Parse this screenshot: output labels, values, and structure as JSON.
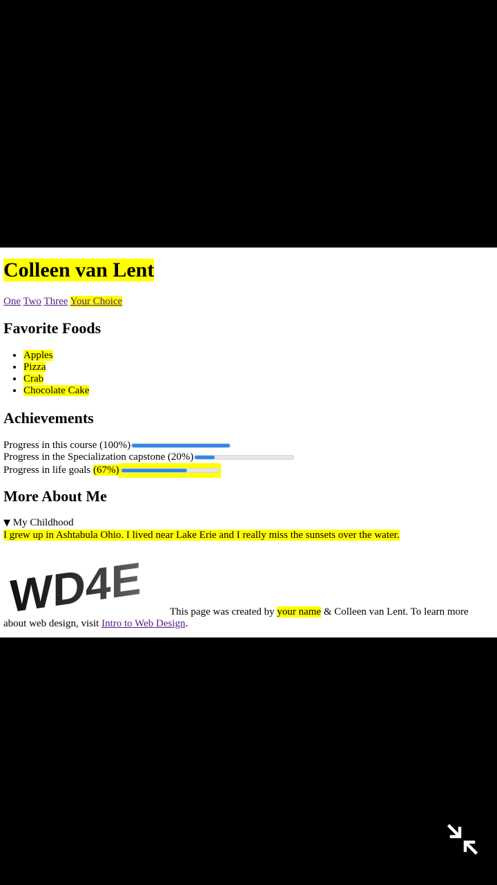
{
  "title": "Colleen van Lent",
  "nav": {
    "links": [
      "One",
      "Two",
      "Three",
      "Your Choice"
    ]
  },
  "favorite_foods": {
    "heading": "Favorite Foods",
    "items": [
      "Apples",
      "Pizza",
      "Crab",
      "Chocolate Cake"
    ]
  },
  "achievements": {
    "heading": "Achievements",
    "rows": [
      {
        "label": "Progress in this course (100%)",
        "value": 100
      },
      {
        "label": "Progress in the Specialization capstone (20%)",
        "value": 20
      },
      {
        "label_prefix": "Progress in life goals ",
        "label_highlight": "(67%)",
        "value": 67
      }
    ]
  },
  "more_about": {
    "heading": "More About Me",
    "summary_marker": "▼",
    "summary": "My Childhood",
    "text": "I grew up in Ashtabula Ohio. I lived near Lake Erie and I really miss the sunsets over the water."
  },
  "logo_text": "WD4E",
  "footer": {
    "before": "This page was created by ",
    "name": "your name",
    "after": " & Colleen van Lent. To learn more about web design, visit ",
    "link": "Intro to Web Design",
    "end": "."
  },
  "colors": {
    "highlight": "#ffff00",
    "progress": "#2f8ae6",
    "link": "#551a8b"
  },
  "icons": {
    "corner": "exit-fullscreen-icon"
  }
}
